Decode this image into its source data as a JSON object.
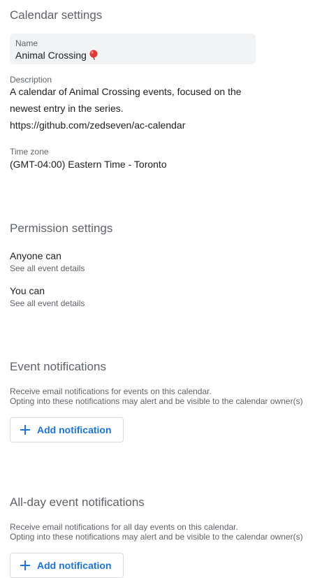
{
  "calendar": {
    "section_title": "Calendar settings",
    "name_label": "Name",
    "name_value": "Animal Crossing",
    "name_emoji_icon": "balloon-icon",
    "description_label": "Description",
    "description_lines": [
      "A calendar of Animal Crossing events, focused on the",
      "newest entry in the series.",
      "https://github.com/zedseven/ac-calendar"
    ],
    "timezone_label": "Time zone",
    "timezone_value": "(GMT-04:00) Eastern Time - Toronto"
  },
  "permissions": {
    "section_title": "Permission settings",
    "anyone_label": "Anyone can",
    "anyone_value": "See all event details",
    "you_label": "You can",
    "you_value": "See all event details"
  },
  "event_notifications": {
    "section_title": "Event notifications",
    "help_line1": "Receive email notifications for events on this calendar.",
    "help_line2": "Opting into these notifications may alert and be visible to the calendar owner(s)",
    "button_label": "Add notification"
  },
  "allday_notifications": {
    "section_title": "All-day event notifications",
    "help_line1": "Receive email notifications for all day events on this calendar.",
    "help_line2": "Opting into these notifications may alert and be visible to the calendar owner(s)",
    "button_label": "Add notification"
  },
  "colors": {
    "accent": "#1a73e8",
    "field_bg": "#f1f3f4",
    "muted_text": "#5f6368"
  }
}
